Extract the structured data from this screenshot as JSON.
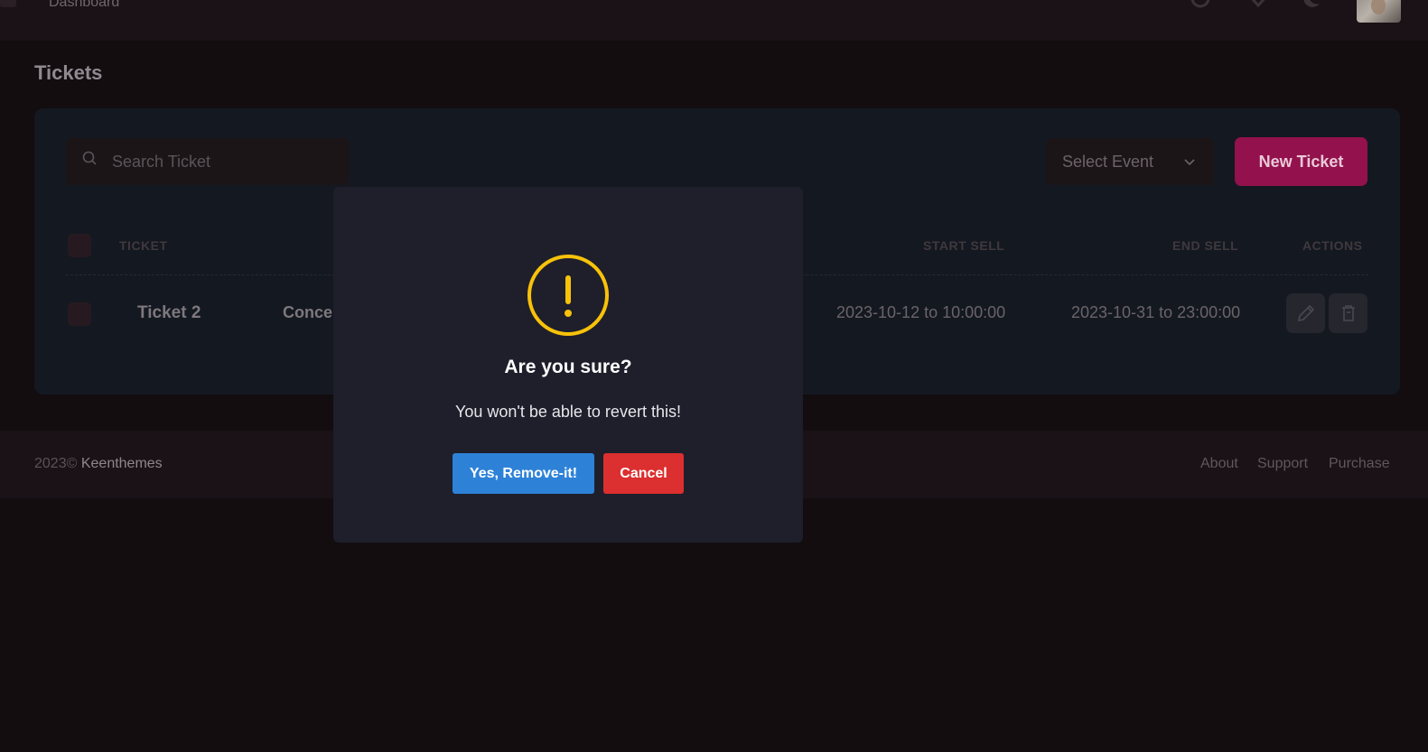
{
  "header": {
    "breadcrumb": "Dashboard",
    "icons": [
      "search-icon",
      "diamond-icon",
      "theme-toggle-icon"
    ]
  },
  "page": {
    "title": "Tickets"
  },
  "toolbar": {
    "search_placeholder": "Search Ticket",
    "select_event_label": "Select Event",
    "new_ticket_label": "New Ticket"
  },
  "table": {
    "columns": [
      "TICKET",
      "START SELL",
      "END SELL",
      "ACTIONS"
    ],
    "rows": [
      {
        "ticket": "Ticket 2",
        "event": "Conce",
        "start_sell": "2023-10-12 to 10:00:00",
        "end_sell": "2023-10-31 to 23:00:00"
      }
    ]
  },
  "footer": {
    "year": "2023©",
    "brand": "Keenthemes",
    "links": [
      "About",
      "Support",
      "Purchase"
    ]
  },
  "modal": {
    "title": "Are you sure?",
    "text": "You won't be able to revert this!",
    "confirm_label": "Yes, Remove-it!",
    "cancel_label": "Cancel",
    "icon": "exclamation-icon",
    "icon_color": "#f8c20a",
    "confirm_color": "#2d82d8",
    "cancel_color": "#dc2f2f"
  },
  "colors": {
    "accent": "#93114d"
  }
}
